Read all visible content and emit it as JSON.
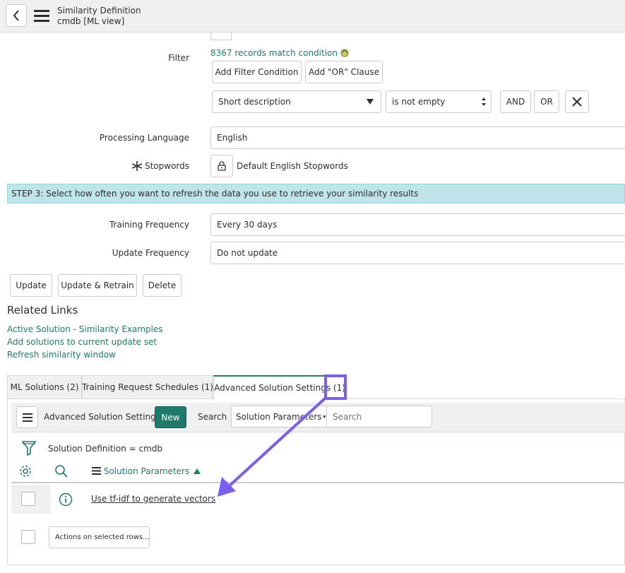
{
  "header": {
    "title": "Similarity Definition",
    "subtitle": "cmdb [ML view]"
  },
  "filter": {
    "label": "Filter",
    "match_text": "8367 records match condition",
    "add_condition": "Add Filter Condition",
    "add_or": "Add \"OR\" Clause",
    "field": "Short description",
    "operator": "is not empty",
    "and_label": "AND",
    "or_label": "OR"
  },
  "processing_language": {
    "label": "Processing Language",
    "value": "English"
  },
  "stopwords": {
    "label": "Stopwords",
    "value": "Default English Stopwords"
  },
  "step3": "STEP 3: Select how often you want to refresh the data you use to retrieve your similarity results",
  "training_frequency": {
    "label": "Training Frequency",
    "value": "Every 30 days"
  },
  "update_frequency": {
    "label": "Update Frequency",
    "value": "Do not update"
  },
  "actions": {
    "update": "Update",
    "update_retrain": "Update & Retrain",
    "delete": "Delete"
  },
  "related_links": {
    "title": "Related Links",
    "items": [
      "Active Solution - Similarity Examples",
      "Add solutions to current update set",
      "Refresh similarity window"
    ]
  },
  "tabs": [
    "ML Solutions (2)",
    "Training Request Schedules (1)",
    "Advanced Solution Settings (1)"
  ],
  "list": {
    "title": "Advanced Solution Settings",
    "new_label": "New",
    "search_label": "Search",
    "search_field": "Solution Parameters",
    "search_placeholder": "Search",
    "breadcrumb": "Solution Definition = cmdb",
    "column": "Solution Parameters",
    "row": "Use tf-idf to generate vectors",
    "actions_select": "Actions on selected rows..."
  },
  "colors": {
    "accent": "#1f7a6c",
    "annotation": "#7b5cf5",
    "banner": "#bfe4ea"
  }
}
